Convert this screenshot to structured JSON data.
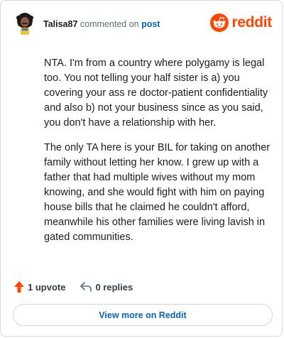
{
  "header": {
    "username": "Talisa87",
    "action_text": "commented on",
    "target_link": "post",
    "brand_text": "reddit",
    "brand_color": "#ff4500"
  },
  "comment": {
    "paragraphs": [
      "NTA. I'm from a country where polygamy is legal too. You not telling your half sister is a) you covering your ass re doctor-patient confidentiality and also b) not your business since as you said, you don't have a relationship with her.",
      "The only TA here is your BIL for taking on another family without letting her know. I grew up with a father that had multiple wives without my mom knowing, and she would fight with him on paying house bills that he claimed he couldn't afford, meanwhile his other families were living lavish in gated communities."
    ]
  },
  "actions": {
    "upvote_icon": "upvote-arrow-icon",
    "upvote_label": "1 upvote",
    "reply_icon": "reply-arrow-icon",
    "reply_label": "0 replies"
  },
  "footer": {
    "view_more_label": "View more on Reddit",
    "link_color": "#0b62b7"
  }
}
